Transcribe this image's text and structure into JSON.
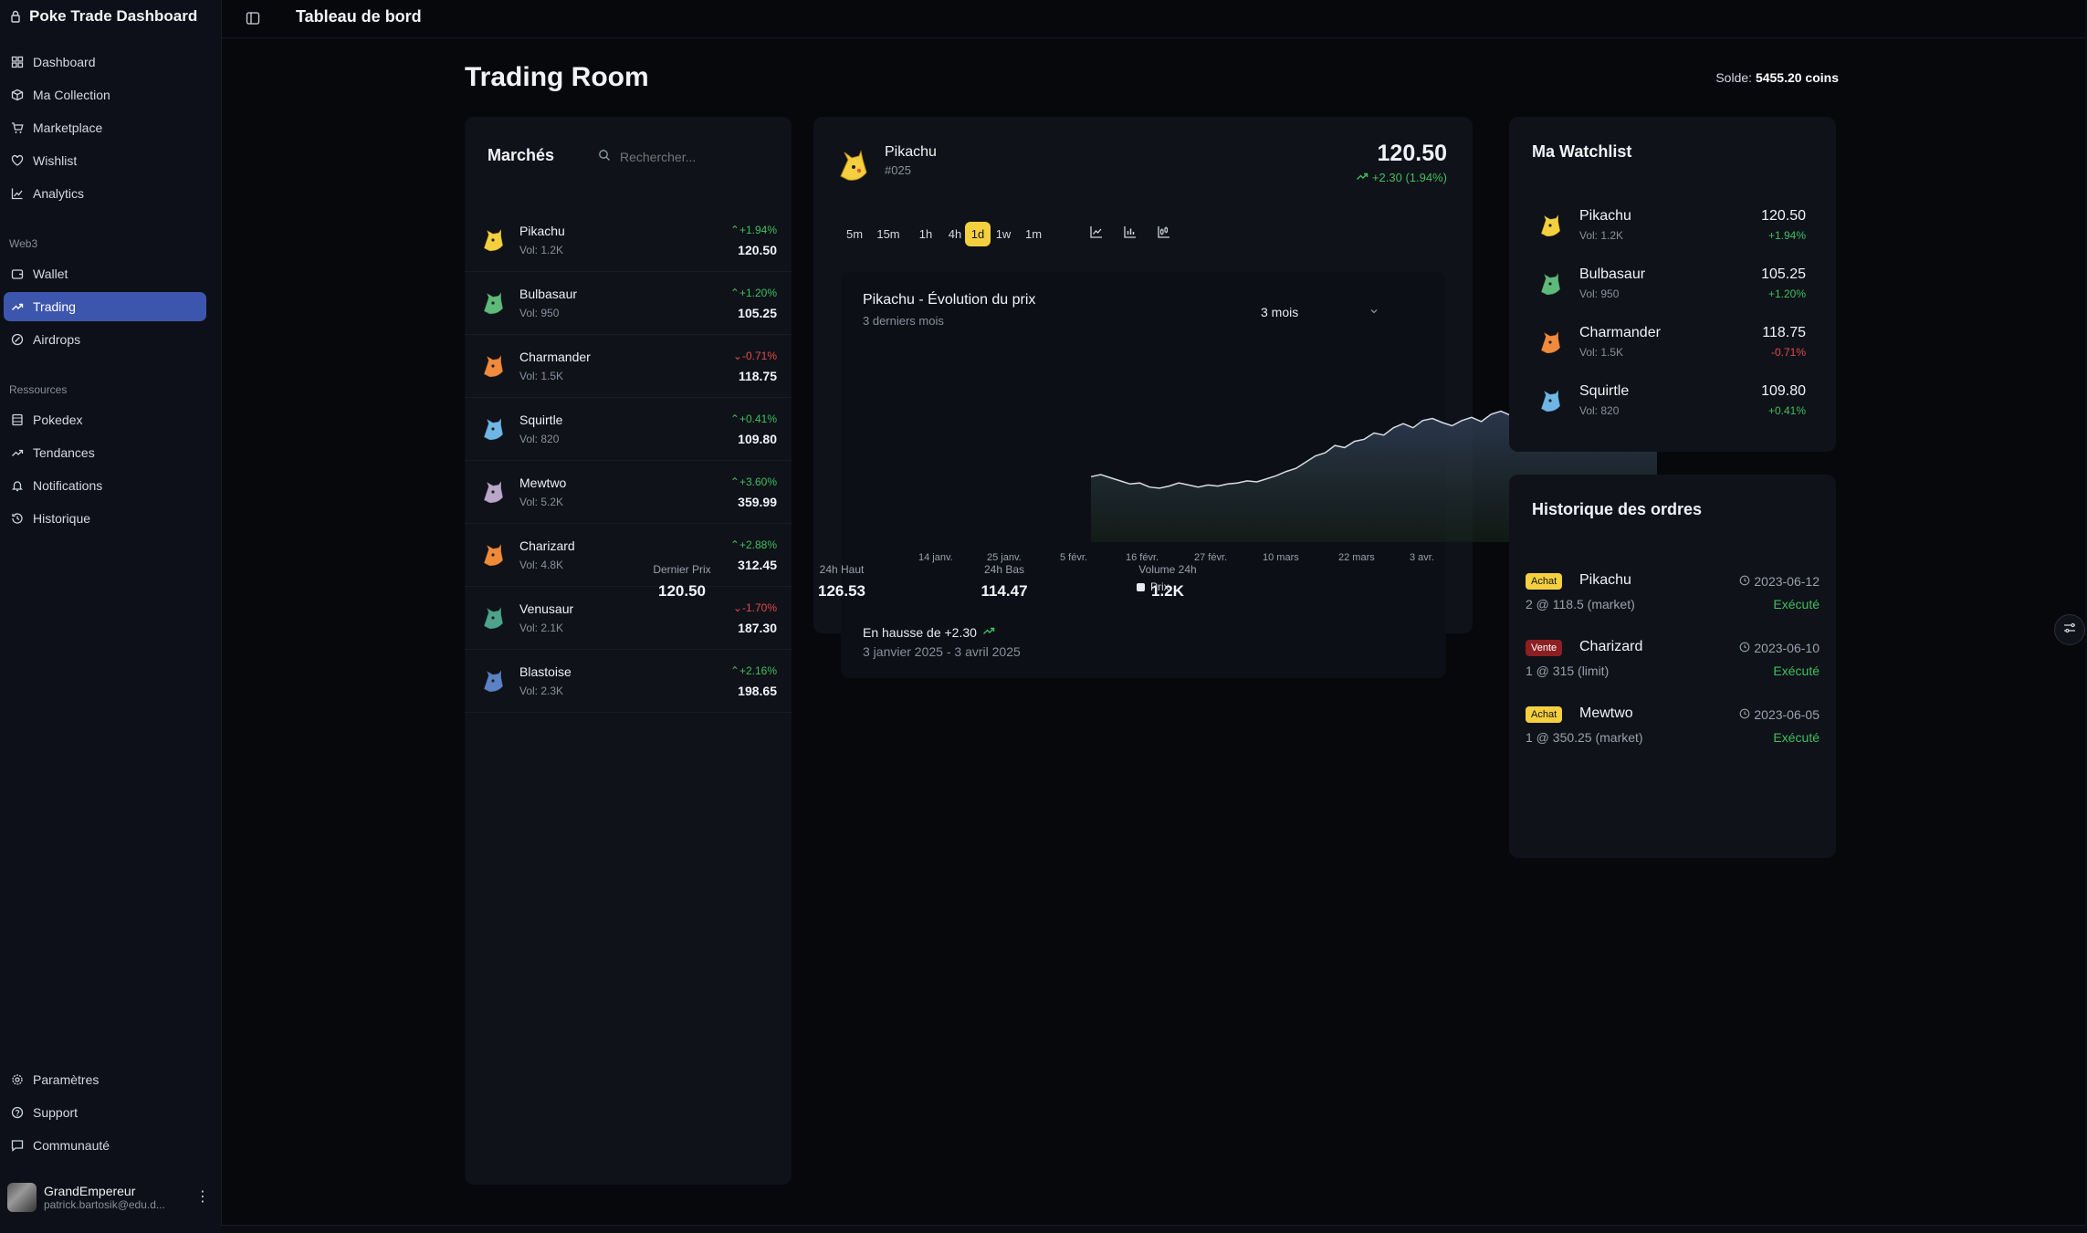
{
  "app": {
    "title": "Poke Trade Dashboard"
  },
  "sidebar": {
    "items": [
      {
        "label": "Dashboard",
        "icon": "grid-icon"
      },
      {
        "label": "Ma Collection",
        "icon": "package-icon"
      },
      {
        "label": "Marketplace",
        "icon": "cart-icon"
      },
      {
        "label": "Wishlist",
        "icon": "heart-icon"
      },
      {
        "label": "Analytics",
        "icon": "line-chart-icon"
      }
    ],
    "web3_section": "Web3",
    "web3_items": [
      {
        "label": "Wallet",
        "icon": "wallet-icon"
      },
      {
        "label": "Trading",
        "icon": "trending-up-icon",
        "active": true
      },
      {
        "label": "Airdrops",
        "icon": "airdrop-icon"
      }
    ],
    "resources_section": "Ressources",
    "resources_items": [
      {
        "label": "Pokedex",
        "icon": "book-icon"
      },
      {
        "label": "Tendances",
        "icon": "trending-up-icon"
      },
      {
        "label": "Notifications",
        "icon": "bell-icon"
      },
      {
        "label": "Historique",
        "icon": "history-icon"
      }
    ],
    "bottom_items": [
      {
        "label": "Paramètres",
        "icon": "gear-icon"
      },
      {
        "label": "Support",
        "icon": "help-icon"
      },
      {
        "label": "Communauté",
        "icon": "chat-icon"
      }
    ],
    "user": {
      "name": "GrandEmpereur",
      "email": "patrick.bartosik@edu.d..."
    }
  },
  "header": {
    "title": "Tableau de bord"
  },
  "page": {
    "title": "Trading Room",
    "balance_label": "Solde:",
    "balance_value": "5455.20 coins"
  },
  "markets": {
    "title": "Marchés",
    "search_placeholder": "Rechercher...",
    "rows": [
      {
        "name": "Pikachu",
        "vol": "Vol: 1.2K",
        "change": "+1.94%",
        "price": "120.50",
        "dir": "up",
        "color": "#f4d03f"
      },
      {
        "name": "Bulbasaur",
        "vol": "Vol: 950",
        "change": "+1.20%",
        "price": "105.25",
        "dir": "up",
        "color": "#5fb97a"
      },
      {
        "name": "Charmander",
        "vol": "Vol: 1.5K",
        "change": "-0.71%",
        "price": "118.75",
        "dir": "down",
        "color": "#f08a3c"
      },
      {
        "name": "Squirtle",
        "vol": "Vol: 820",
        "change": "+0.41%",
        "price": "109.80",
        "dir": "up",
        "color": "#6fb6e6"
      },
      {
        "name": "Mewtwo",
        "vol": "Vol: 5.2K",
        "change": "+3.60%",
        "price": "359.99",
        "dir": "up",
        "color": "#b9a6c9"
      },
      {
        "name": "Charizard",
        "vol": "Vol: 4.8K",
        "change": "+2.88%",
        "price": "312.45",
        "dir": "up",
        "color": "#ef8a3a"
      },
      {
        "name": "Venusaur",
        "vol": "Vol: 2.1K",
        "change": "-1.70%",
        "price": "187.30",
        "dir": "down",
        "color": "#4fa38a"
      },
      {
        "name": "Blastoise",
        "vol": "Vol: 2.3K",
        "change": "+2.16%",
        "price": "198.65",
        "dir": "up",
        "color": "#5b82c4"
      }
    ]
  },
  "detail": {
    "name": "Pikachu",
    "number": "#025",
    "price": "120.50",
    "change": "+2.30 (1.94%)",
    "timeframes": [
      "5m",
      "15m",
      "1h",
      "4h",
      "1d",
      "1w",
      "1m"
    ],
    "active_timeframe": "1d",
    "chart_title": "Pikachu - Évolution du prix",
    "chart_subtitle": "3 derniers mois",
    "period_select": "3 mois",
    "stats": [
      {
        "label": "Dernier Prix",
        "value": "120.50"
      },
      {
        "label": "24h Haut",
        "value": "126.53"
      },
      {
        "label": "24h Bas",
        "value": "114.47"
      },
      {
        "label": "Volume 24h",
        "value": "1.2K"
      }
    ],
    "legend": "Prix",
    "trend_text": "En hausse de +2.30",
    "date_range": "3 janvier 2025 - 3 avril 2025"
  },
  "chart_data": {
    "type": "area",
    "title": "Pikachu - Évolution du prix",
    "subtitle": "3 derniers mois",
    "x_ticks": [
      "14 janv.",
      "25 janv.",
      "5 févr.",
      "16 févr.",
      "27 févr.",
      "10 mars",
      "22 mars",
      "3 avr."
    ],
    "series": [
      {
        "name": "Prix",
        "values": [
          118.2,
          118.4,
          118.1,
          117.8,
          117.5,
          117.6,
          117.2,
          117.1,
          117.3,
          117.6,
          117.4,
          117.2,
          117.4,
          117.3,
          117.5,
          117.6,
          117.8,
          117.7,
          118.0,
          118.3,
          118.7,
          119.0,
          119.6,
          120.2,
          120.5,
          121.2,
          121.0,
          121.6,
          121.8,
          122.4,
          122.2,
          122.9,
          123.3,
          122.9,
          123.6,
          123.8,
          123.4,
          123.1,
          123.6,
          123.9,
          123.5,
          124.2,
          124.5,
          124.1,
          124.6,
          124.3,
          124.9,
          125.2,
          125.9,
          125.4,
          125.0,
          125.5,
          125.1,
          125.6,
          125.9,
          125.3,
          124.9,
          125.3,
          125.7
        ],
        "color": "#d8dbe3"
      }
    ],
    "grid": false,
    "legend": "bottom"
  },
  "watchlist": {
    "title": "Ma Watchlist",
    "rows": [
      {
        "name": "Pikachu",
        "vol": "Vol: 1.2K",
        "price": "120.50",
        "change": "+1.94%",
        "dir": "up",
        "color": "#f4d03f"
      },
      {
        "name": "Bulbasaur",
        "vol": "Vol: 950",
        "price": "105.25",
        "change": "+1.20%",
        "dir": "up",
        "color": "#5fb97a"
      },
      {
        "name": "Charmander",
        "vol": "Vol: 1.5K",
        "price": "118.75",
        "change": "-0.71%",
        "dir": "down",
        "color": "#f08a3c"
      },
      {
        "name": "Squirtle",
        "vol": "Vol: 820",
        "price": "109.80",
        "change": "+0.41%",
        "dir": "up",
        "color": "#6fb6e6"
      }
    ]
  },
  "orders": {
    "title": "Historique des ordres",
    "rows": [
      {
        "type": "Achat",
        "name": "Pikachu",
        "date": "2023-06-12",
        "detail": "2 @ 118.5 (market)",
        "status": "Exécuté",
        "badge_color": "#f4d03f"
      },
      {
        "type": "Vente",
        "name": "Charizard",
        "date": "2023-06-10",
        "detail": "1 @ 315 (limit)",
        "status": "Exécuté",
        "badge_color": "#8c1f22"
      },
      {
        "type": "Achat",
        "name": "Mewtwo",
        "date": "2023-06-05",
        "detail": "1 @ 350.25 (market)",
        "status": "Exécuté",
        "badge_color": "#f4d03f"
      }
    ]
  }
}
